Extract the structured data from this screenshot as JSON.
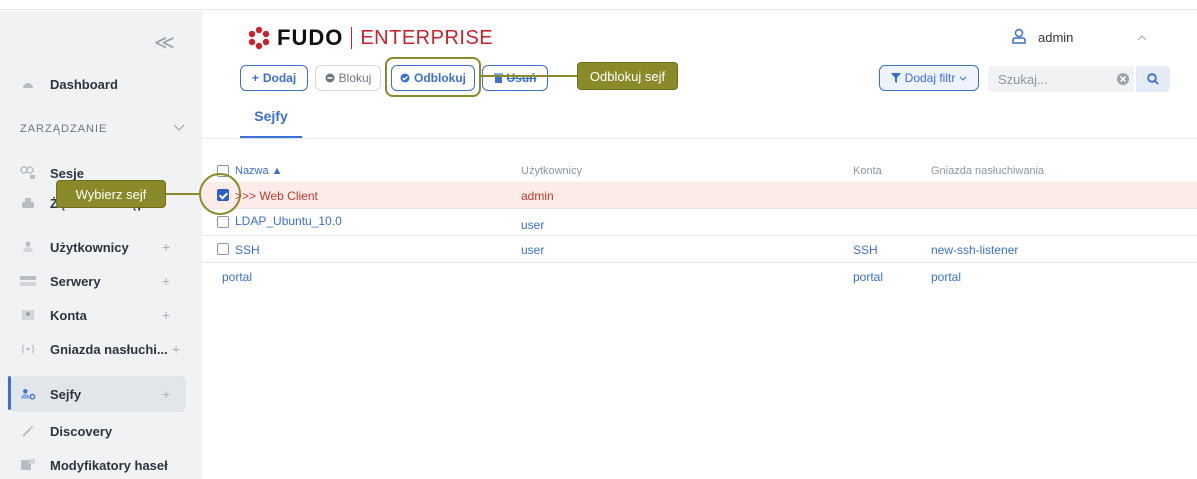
{
  "app": {
    "logo_main": "FUDO",
    "logo_sub": "ENTERPRISE",
    "user": "admin"
  },
  "colors": {
    "accent": "#3b6fd1",
    "brand": "#c8232c",
    "callout": "#8b8a2a"
  },
  "sidebar": {
    "collapse_glyph": "≪",
    "section": "ZARZĄDZANIE",
    "items": [
      {
        "label": "Dashboard",
        "icon": "dashboard-icon"
      },
      {
        "label": "Sesje",
        "icon": "sessions-icon"
      },
      {
        "label": "Żądania dostępu",
        "icon": "access-requests-icon"
      },
      {
        "label": "Użytkownicy",
        "icon": "users-icon",
        "plus": "+"
      },
      {
        "label": "Serwery",
        "icon": "servers-icon",
        "plus": "+"
      },
      {
        "label": "Konta",
        "icon": "accounts-icon",
        "plus": "+"
      },
      {
        "label": "Gniazda nasłuchi...",
        "icon": "listeners-icon",
        "plus": "+"
      },
      {
        "label": "Sejfy",
        "icon": "safes-icon",
        "plus": "+"
      },
      {
        "label": "Discovery",
        "icon": "discovery-icon"
      },
      {
        "label": "Modyfikatory haseł",
        "icon": "password-modifiers-icon"
      }
    ]
  },
  "toolbar": {
    "add": "Dodaj",
    "block": "Blokuj",
    "unblock": "Odblokuj",
    "delete": "Usuń",
    "filter": "Dodaj filtr",
    "search_placeholder": "Szukaj..."
  },
  "callouts": {
    "unblock": "Odblokuj sejf",
    "select": "Wybierz sejf"
  },
  "tabs": [
    {
      "label": "Sejfy"
    }
  ],
  "table": {
    "columns": {
      "name": "Nazwa ▲",
      "users": "Użytkownicy",
      "accounts": "Konta",
      "listeners": "Gniazda nasłuchiwania"
    },
    "rows": [
      {
        "name": ">>> Web Client",
        "users": "admin",
        "accounts": "",
        "listeners": "",
        "checked": true,
        "has_checkbox": true
      },
      {
        "name": "LDAP_Ubuntu_10.0",
        "users": "user",
        "accounts": "",
        "listeners": "",
        "checked": false,
        "has_checkbox": true
      },
      {
        "name": "SSH",
        "users": "user",
        "accounts": "SSH",
        "listeners": "new-ssh-listener",
        "checked": false,
        "has_checkbox": true
      },
      {
        "name": "portal",
        "users": "",
        "accounts": "portal",
        "listeners": "portal",
        "checked": false,
        "has_checkbox": false
      }
    ]
  }
}
